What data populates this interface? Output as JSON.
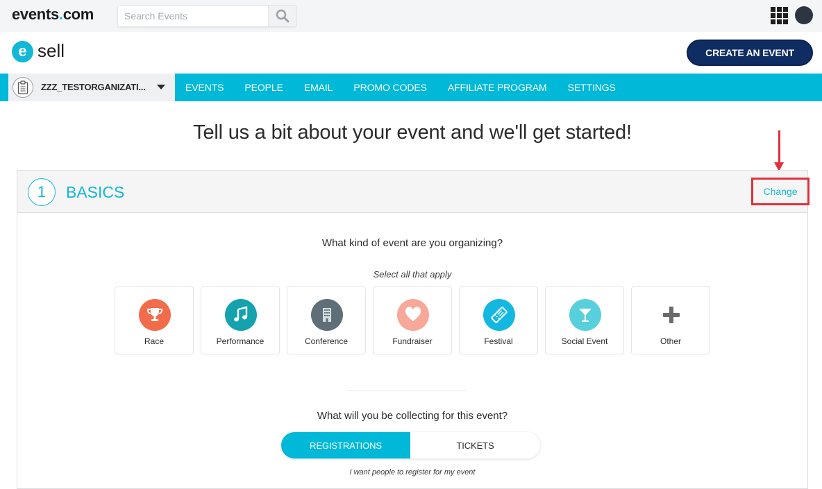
{
  "topbar": {
    "brand_prefix": "events",
    "brand_dot": ".",
    "brand_suffix": "com",
    "search_placeholder": "Search Events",
    "search_icon": "search-icon",
    "apps_icon": "apps-grid-icon"
  },
  "header": {
    "logo_letter": "e",
    "logo_text": "sell",
    "create_button": "CREATE AN EVENT"
  },
  "nav": {
    "org_name": "ZZZ_TESTORGANIZATI...",
    "items": [
      "EVENTS",
      "PEOPLE",
      "EMAIL",
      "PROMO CODES",
      "AFFILIATE PROGRAM",
      "SETTINGS"
    ]
  },
  "main": {
    "headline": "Tell us a bit about your event and we'll get started!",
    "step": {
      "number": "1",
      "title": "BASICS",
      "change_label": "Change"
    },
    "event_question": "What kind of event are you organizing?",
    "event_hint": "Select all that apply",
    "event_types": [
      {
        "label": "Race",
        "icon": "trophy-icon",
        "color": "#f26b4a"
      },
      {
        "label": "Performance",
        "icon": "music-note-icon",
        "color": "#14a2ae"
      },
      {
        "label": "Conference",
        "icon": "building-icon",
        "color": "#5e6f78"
      },
      {
        "label": "Fundraiser",
        "icon": "heart-icon",
        "color": "#f8a898"
      },
      {
        "label": "Festival",
        "icon": "ticket-icon",
        "color": "#12b8e0"
      },
      {
        "label": "Social Event",
        "icon": "cocktail-glass-icon",
        "color": "#58cfdc"
      },
      {
        "label": "Other",
        "icon": "plus-icon",
        "color": "#6a6a6a"
      }
    ],
    "collect_question": "What will you be collecting for this event?",
    "collect_options": [
      "REGISTRATIONS",
      "TICKETS"
    ],
    "collect_selected": "REGISTRATIONS",
    "collect_hint": "I want people to register for my event"
  },
  "colors": {
    "accent": "#00b8d8",
    "navy": "#0f2d63",
    "highlight": "#e0303b"
  }
}
